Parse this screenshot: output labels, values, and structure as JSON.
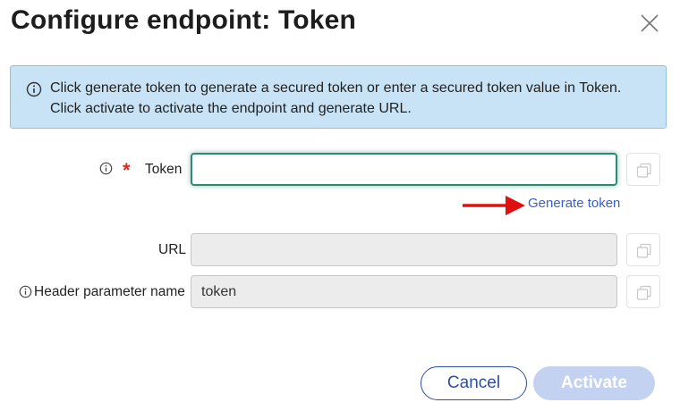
{
  "dialog": {
    "title": "Configure endpoint: Token",
    "close_icon": "close-icon"
  },
  "info_banner": {
    "icon": "info-icon",
    "line1": "Click generate token to generate a secured token or enter a secured token value in Token.",
    "line2": "Click activate to activate the endpoint and generate URL."
  },
  "fields": {
    "token": {
      "label": "Token",
      "required": true,
      "value": "",
      "info_icon": "info-icon",
      "copy_icon": "copy-icon"
    },
    "url": {
      "label": "URL",
      "value": "",
      "copy_icon": "copy-icon"
    },
    "header_parameter": {
      "label": "Header parameter name",
      "value": "token",
      "info_icon": "info-icon",
      "copy_icon": "copy-icon"
    }
  },
  "generate_token_link": "Generate token",
  "annotation_arrow_color": "#e01010",
  "buttons": {
    "cancel": "Cancel",
    "activate": "Activate"
  },
  "colors": {
    "banner_bg": "#c8e3f5",
    "focus_border": "#2e8b72",
    "link": "#3a5fcd",
    "primary_disabled": "#c3d2f0",
    "required": "#d62d20"
  }
}
